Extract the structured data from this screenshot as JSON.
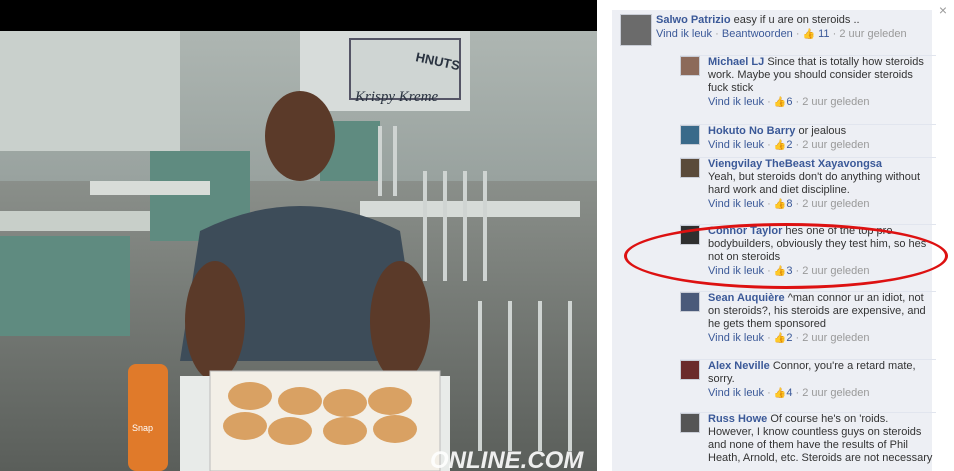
{
  "close_glyph": "×",
  "watermark": "ONLINE.COM",
  "photo_signage": {
    "store_sign": "Krispy Kreme",
    "partial_sign": "HNUTS",
    "bottle_label": "Snap"
  },
  "comments": [
    {
      "author": "Salwo Patrizio",
      "text": "easy if u are on steroids ..",
      "like": "Vind ik leuk",
      "reply": "Beantwoorden",
      "likes": "11",
      "time": "2 uur geleden"
    },
    {
      "author": "Michael LJ",
      "text": "Since that is totally how steroids work. Maybe you should consider steroids fuck stick",
      "like": "Vind ik leuk",
      "likes": "6",
      "time": "2 uur geleden"
    },
    {
      "author": "Hokuto No Barry",
      "text": "or jealous",
      "like": "Vind ik leuk",
      "likes": "2",
      "time": "2 uur geleden"
    },
    {
      "author": "Viengvilay TheBeast Xayavongsa",
      "text": "Yeah, but steroids don't do anything without hard work and diet discipline.",
      "like": "Vind ik leuk",
      "likes": "8",
      "time": "2 uur geleden"
    },
    {
      "author": "Connor Taylor",
      "text": "hes one of the top pro bodybuilders, obviously they test him, so hes not on steroids",
      "like": "Vind ik leuk",
      "likes": "3",
      "time": "2 uur geleden"
    },
    {
      "author": "Sean Auquière",
      "text": "^man connor ur an idiot, not on steroids?, his steroids are expensive, and he gets them sponsored",
      "like": "Vind ik leuk",
      "likes": "2",
      "time": "2 uur geleden"
    },
    {
      "author": "Alex Neville",
      "text": "Connor, you're a retard mate, sorry.",
      "like": "Vind ik leuk",
      "likes": "4",
      "time": "2 uur geleden"
    },
    {
      "author": "Russ Howe",
      "text": "Of course he's on 'roids. However, I know countless guys on steroids and none of them have the results of Phil Heath, Arnold, etc. Steroids are not necessary",
      "like": "",
      "likes": "",
      "time": ""
    }
  ],
  "colors": {
    "link": "#3b5998",
    "panel": "#edeff4",
    "highlight": "#dd1111"
  }
}
